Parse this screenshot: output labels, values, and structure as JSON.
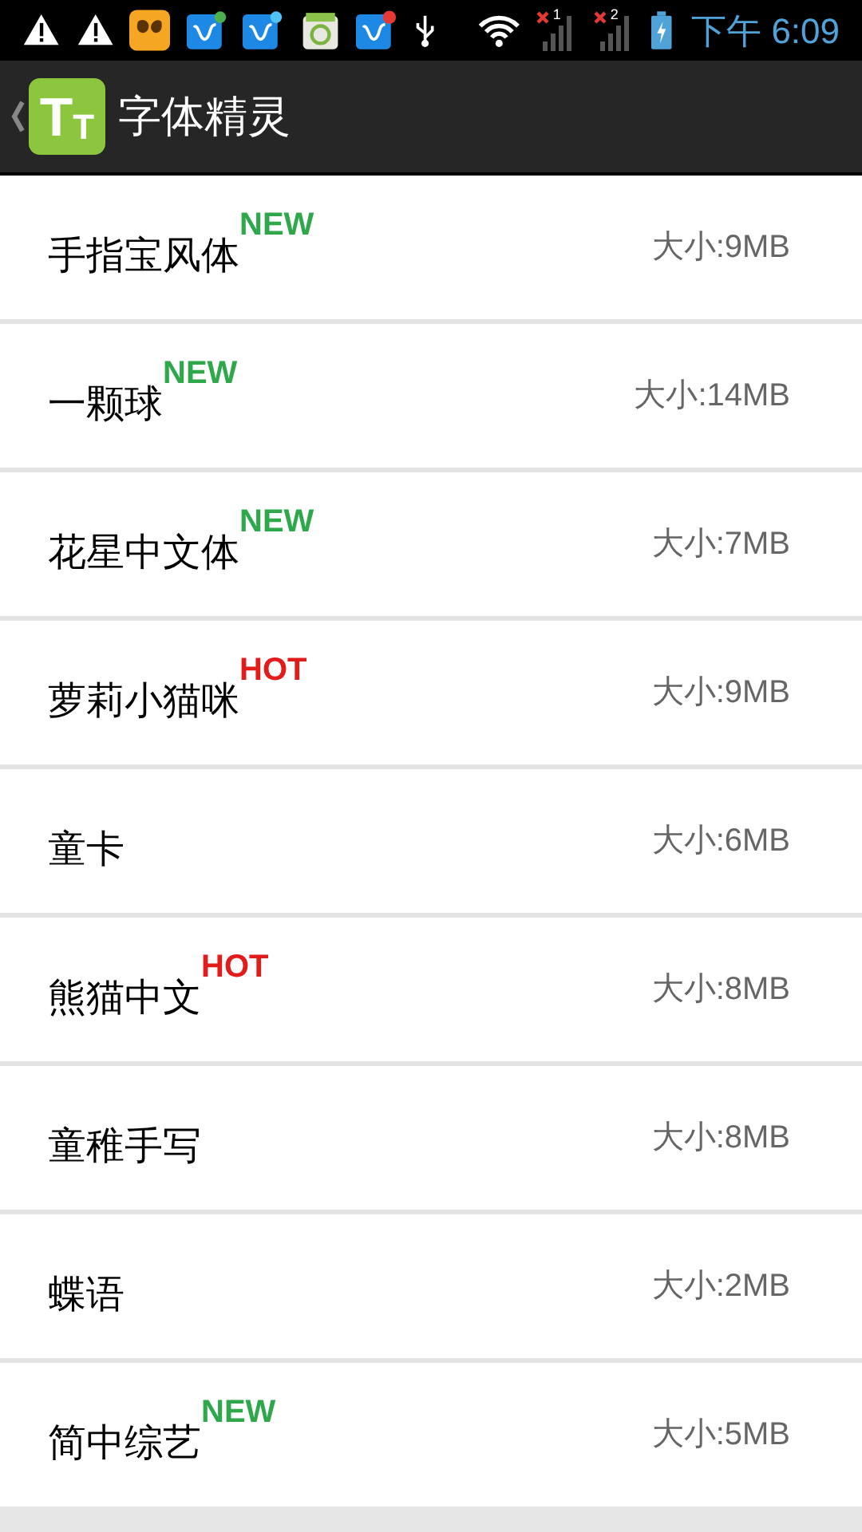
{
  "status_bar": {
    "sim_slots": [
      "1",
      "2"
    ],
    "time": "下午 6:09"
  },
  "header": {
    "logo_letters": [
      "T",
      "T"
    ],
    "title": "字体精灵"
  },
  "fonts": [
    {
      "name": "手指宝风体",
      "kind": "new",
      "badge_text": "NEW",
      "size": "大小:9MB"
    },
    {
      "name": "一颗球",
      "kind": "new",
      "badge_text": "NEW",
      "size": "大小:14MB"
    },
    {
      "name": "花星中文体",
      "kind": "new",
      "badge_text": "NEW",
      "size": "大小:7MB"
    },
    {
      "name": "萝莉小猫咪",
      "kind": "hot",
      "badge_text": "HOT",
      "size": "大小:9MB"
    },
    {
      "name": "童卡",
      "size": "大小:6MB"
    },
    {
      "name": "熊猫中文",
      "kind": "hot",
      "badge_text": "HOT",
      "size": "大小:8MB"
    },
    {
      "name": "童稚手写",
      "size": "大小:8MB"
    },
    {
      "name": "蝶语",
      "size": "大小:2MB"
    },
    {
      "name": "简中综艺",
      "kind": "new",
      "badge_text": "NEW",
      "size": "大小:5MB"
    }
  ]
}
